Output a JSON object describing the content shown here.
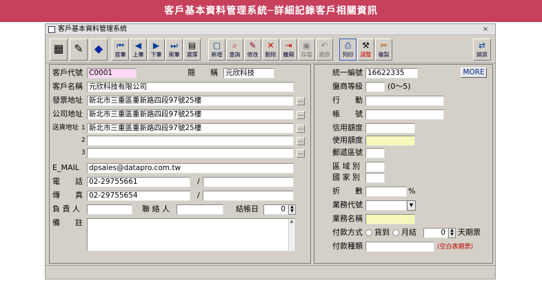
{
  "banner": "客戶基本資料管理系統─詳細記錄客戶相關資訊",
  "window": {
    "title": "客戶基本資料管理系統",
    "close": "×"
  },
  "toolbar": {
    "nav": [
      "首筆",
      "上筆",
      "下筆",
      "尾筆",
      "選擇"
    ],
    "actions": [
      "新增",
      "查詢",
      "修改",
      "刪除",
      "離開",
      "存檔",
      "還原",
      "列印",
      "調整",
      "複製"
    ],
    "right": "銷貨"
  },
  "left": {
    "customer_code_label": "客戶代號",
    "customer_code": "C0001",
    "short_name_label": "簡　　稱",
    "short_name": "元欣科技",
    "customer_name_label": "客戶名稱",
    "customer_name": "元欣科技有限公司",
    "invoice_addr_label": "發票地址",
    "invoice_addr": "新北市三重區重新路四段97號25樓",
    "company_addr_label": "公司地址",
    "company_addr": "新北市三重區重新路四段97號25樓",
    "delivery_addr_label": "送貨地址",
    "delivery_addr_1": "新北市三重區重新路四段97號25樓",
    "delivery_addr_2": "",
    "delivery_addr_3": "",
    "delivery_idx": [
      "1",
      "2",
      "3"
    ],
    "email_label": "E_MAIL",
    "email": "dpsales@datapro.com.tw",
    "phone_label": "電　　話",
    "phone": "02-29755661",
    "phone2": "",
    "fax_label": "傳　　真",
    "fax": "02-29755654",
    "fax2": "",
    "sep": "/",
    "owner_label": "負 責 人",
    "owner": "",
    "contact_label": "聯 絡 人",
    "contact": "",
    "closing_day_label": "結帳日",
    "closing_day": "0",
    "note_label": "備　　註",
    "note": ""
  },
  "right": {
    "more_button": "MORE",
    "tax_id_label": "統一編號",
    "tax_id": "16622335",
    "dealer_level_label": "盤商等級",
    "dealer_level": "",
    "dealer_level_range": "(0～5)",
    "industry_label": "行　　動",
    "industry": "",
    "account_label": "帳　　號",
    "account": "",
    "credit_limit_label": "信用額度",
    "credit_limit": "",
    "used_credit_label": "使用額度",
    "used_credit": "",
    "zip_label": "郵遞區號",
    "zip": "",
    "region_label": "區 域 別",
    "region": "",
    "country_label": "國 家 別",
    "country": "",
    "discount_label": "折　　數",
    "discount": "",
    "percent": "%",
    "sales_code_label": "業務代號",
    "sales_code": "",
    "sales_name_label": "業務名稱",
    "sales_name": "",
    "pay_method_label": "付款方式",
    "pay_opt_1": "貨到",
    "pay_opt_2": "月結",
    "pay_days": "0",
    "days_suffix": "天期票",
    "pay_type_label": "付款種類",
    "pay_type": "",
    "pay_type_hint": "(空白表期票)"
  },
  "colors": {
    "banner": "#c7405c",
    "pink": "#fcd8f4",
    "yellow": "#f5f8b8",
    "hint": "#c00000"
  }
}
